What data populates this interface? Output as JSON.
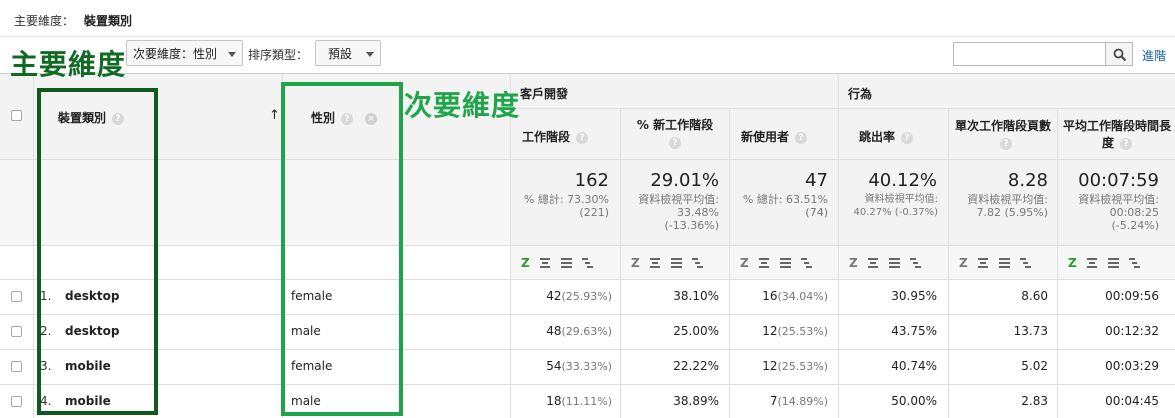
{
  "primary_dimension": {
    "label": "主要維度：",
    "value": "裝置類別"
  },
  "toolbar": {
    "secondary_dim_dropdown": "次要維度：性別",
    "sort_type_label": "排序類型：",
    "sort_dropdown": "預設",
    "search_placeholder": "",
    "advanced_link": "進階"
  },
  "annotations": {
    "primary": "主要維度",
    "secondary": "次要維度"
  },
  "table": {
    "col_primary": "裝置類別",
    "col_secondary": "性別",
    "sort_arrow": "↑",
    "group_acquisition": "客戶開發",
    "group_behavior": "行為",
    "metrics": [
      {
        "name": "工作階段"
      },
      {
        "name": "% 新工作階段"
      },
      {
        "name": "新使用者"
      },
      {
        "name": "跳出率"
      },
      {
        "name": "單次工作階段頁數"
      },
      {
        "name": "平均工作階段時間長度"
      }
    ],
    "totals": [
      {
        "value": "162",
        "sub": [
          "% 總計: 73.30%",
          "(221)"
        ]
      },
      {
        "value": "29.01%",
        "sub": [
          "資料檢視平均值:",
          "33.48%",
          "(-13.36%)"
        ]
      },
      {
        "value": "47",
        "sub": [
          "% 總計: 63.51%",
          "(74)"
        ]
      },
      {
        "value": "40.12%",
        "sub": [
          "資料檢視平均值:",
          "40.27% (-0.37%)"
        ]
      },
      {
        "value": "8.28",
        "sub": [
          "資料檢視平均值:",
          "7.82 (5.95%)"
        ]
      },
      {
        "value": "00:07:59",
        "sub": [
          "資料檢視平均值:",
          "00:08:25",
          "(-5.24%)"
        ]
      }
    ],
    "rows": [
      {
        "idx": "1.",
        "device": "desktop",
        "gender": "female",
        "sessions": "42",
        "sessions_pct": "(25.93%)",
        "new_sessions": "38.10%",
        "new_users": "16",
        "new_users_pct": "(34.04%)",
        "bounce": "30.95%",
        "pages": "8.60",
        "duration": "00:09:56"
      },
      {
        "idx": "2.",
        "device": "desktop",
        "gender": "male",
        "sessions": "48",
        "sessions_pct": "(29.63%)",
        "new_sessions": "25.00%",
        "new_users": "12",
        "new_users_pct": "(25.53%)",
        "bounce": "43.75%",
        "pages": "13.73",
        "duration": "00:12:32"
      },
      {
        "idx": "3.",
        "device": "mobile",
        "gender": "female",
        "sessions": "54",
        "sessions_pct": "(33.33%)",
        "new_sessions": "22.22%",
        "new_users": "12",
        "new_users_pct": "(25.53%)",
        "bounce": "40.74%",
        "pages": "5.02",
        "duration": "00:03:29"
      },
      {
        "idx": "4.",
        "device": "mobile",
        "gender": "male",
        "sessions": "18",
        "sessions_pct": "(11.11%)",
        "new_sessions": "38.89%",
        "new_users": "7",
        "new_users_pct": "(14.89%)",
        "bounce": "50.00%",
        "pages": "2.83",
        "duration": "00:04:45"
      }
    ]
  },
  "colors": {
    "primary_box": "#0f5a1c",
    "secondary_box": "#20a44a",
    "link": "#1a5ea8",
    "active_z": "#2d9b2d"
  }
}
